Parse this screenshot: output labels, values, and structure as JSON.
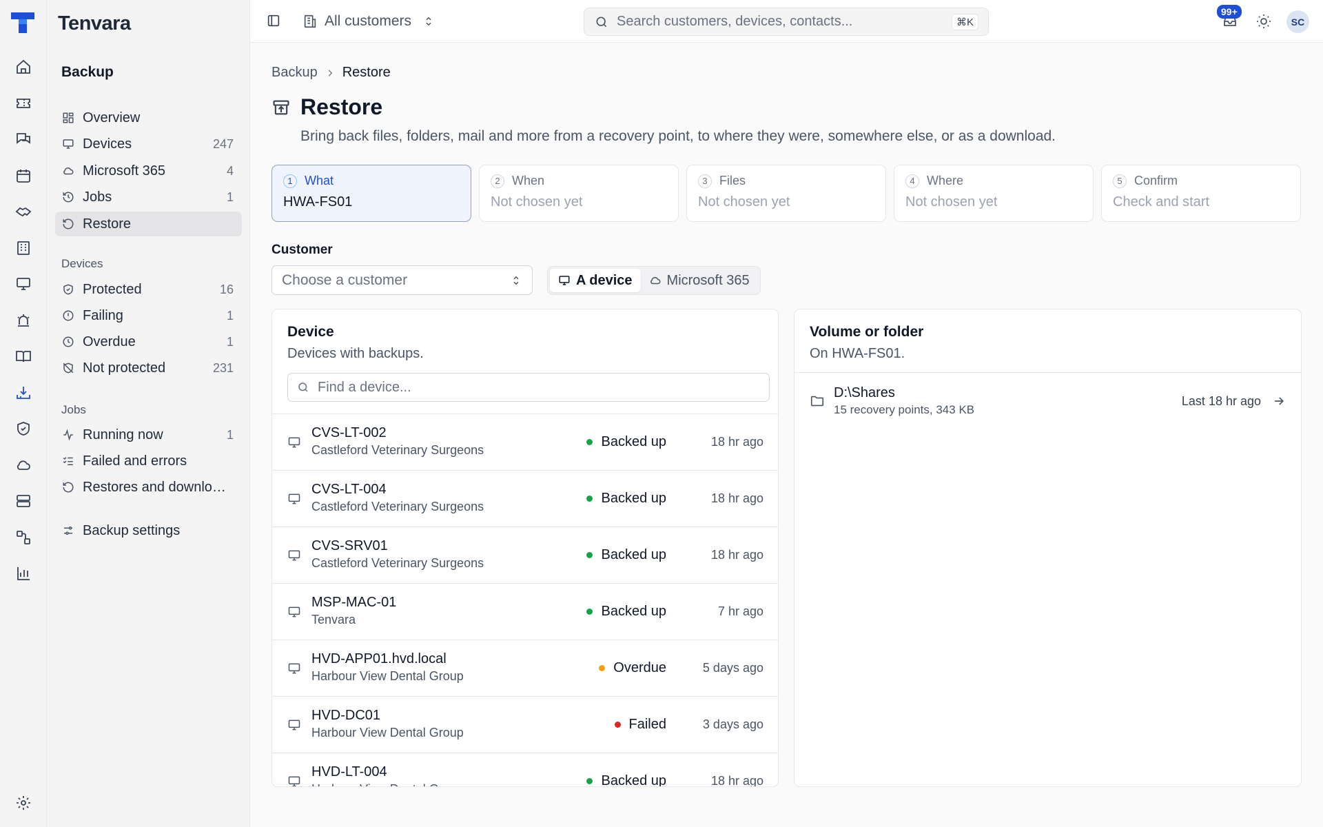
{
  "app": {
    "brand": "Tenvara"
  },
  "sidebar": {
    "section_title": "Backup",
    "items": [
      {
        "label": "Overview",
        "count": "",
        "icon": "grid-icon"
      },
      {
        "label": "Devices",
        "count": "247",
        "icon": "monitor-icon"
      },
      {
        "label": "Microsoft 365",
        "count": "4",
        "icon": "cloud-icon"
      },
      {
        "label": "Jobs",
        "count": "1",
        "icon": "history-icon"
      },
      {
        "label": "Restore",
        "count": "",
        "icon": "restore-icon",
        "active": true
      }
    ],
    "devices_group": {
      "label": "Devices",
      "items": [
        {
          "label": "Protected",
          "count": "16",
          "icon": "shield-check-icon"
        },
        {
          "label": "Failing",
          "count": "1",
          "icon": "alert-circle-icon"
        },
        {
          "label": "Overdue",
          "count": "1",
          "icon": "clock-icon"
        },
        {
          "label": "Not protected",
          "count": "231",
          "icon": "shield-off-icon"
        }
      ]
    },
    "jobs_group": {
      "label": "Jobs",
      "items": [
        {
          "label": "Running now",
          "count": "1",
          "icon": "activity-icon"
        },
        {
          "label": "Failed and errors",
          "count": "",
          "icon": "list-checks-icon"
        },
        {
          "label": "Restores and downloads",
          "count": "",
          "icon": "restore-icon"
        }
      ]
    },
    "settings": {
      "label": "Backup settings",
      "icon": "sliders-icon"
    }
  },
  "topbar": {
    "scope": "All customers",
    "search_placeholder": "Search customers, devices, contacts...",
    "shortcut": "⌘K",
    "notifications_badge": "99+",
    "avatar": "SC"
  },
  "breadcrumb": {
    "parent": "Backup",
    "current": "Restore"
  },
  "page": {
    "title": "Restore",
    "description": "Bring back files, folders, mail and more from a recovery point, to where they were, somewhere else, or as a download."
  },
  "steps": [
    {
      "num": "1",
      "label": "What",
      "value": "HWA-FS01",
      "active": true
    },
    {
      "num": "2",
      "label": "When",
      "value": "Not chosen yet"
    },
    {
      "num": "3",
      "label": "Files",
      "value": "Not chosen yet"
    },
    {
      "num": "4",
      "label": "Where",
      "value": "Not chosen yet"
    },
    {
      "num": "5",
      "label": "Confirm",
      "value": "Check and start"
    }
  ],
  "customer": {
    "label": "Customer",
    "placeholder": "Choose a customer",
    "source_options": [
      {
        "label": "A device",
        "icon": "monitor-icon",
        "active": true
      },
      {
        "label": "Microsoft 365",
        "icon": "cloud-icon"
      }
    ]
  },
  "device_card": {
    "title": "Device",
    "subtitle": "Devices with backups.",
    "search_placeholder": "Find a device...",
    "rows": [
      {
        "name": "CVS-LT-002",
        "customer": "Castleford Veterinary Surgeons",
        "status": "Backed up",
        "status_color": "#16a34a",
        "when": "18 hr ago"
      },
      {
        "name": "CVS-LT-004",
        "customer": "Castleford Veterinary Surgeons",
        "status": "Backed up",
        "status_color": "#16a34a",
        "when": "18 hr ago"
      },
      {
        "name": "CVS-SRV01",
        "customer": "Castleford Veterinary Surgeons",
        "status": "Backed up",
        "status_color": "#16a34a",
        "when": "18 hr ago"
      },
      {
        "name": "MSP-MAC-01",
        "customer": "Tenvara",
        "status": "Backed up",
        "status_color": "#16a34a",
        "when": "7 hr ago"
      },
      {
        "name": "HVD-APP01.hvd.local",
        "customer": "Harbour View Dental Group",
        "status": "Overdue",
        "status_color": "#f59e0b",
        "when": "5 days ago"
      },
      {
        "name": "HVD-DC01",
        "customer": "Harbour View Dental Group",
        "status": "Failed",
        "status_color": "#dc2626",
        "when": "3 days ago"
      },
      {
        "name": "HVD-LT-004",
        "customer": "Harbour View Dental Group",
        "status": "Backed up",
        "status_color": "#16a34a",
        "when": "18 hr ago"
      }
    ]
  },
  "volume_card": {
    "title": "Volume or folder",
    "subtitle": "On HWA-FS01.",
    "rows": [
      {
        "name": "D:\\Shares",
        "meta": "15 recovery points, 343 KB",
        "last": "Last 18 hr ago"
      }
    ]
  }
}
